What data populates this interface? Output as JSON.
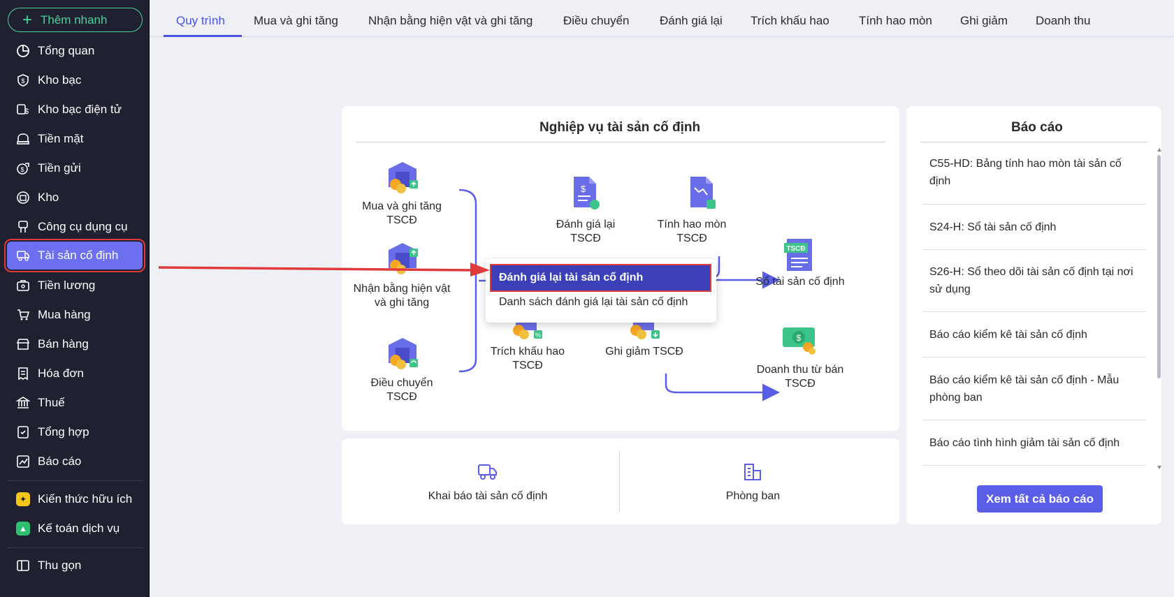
{
  "sidebar": {
    "quick_add": "Thêm nhanh",
    "items": [
      {
        "label": "Tổng quan",
        "icon": "pie-chart-icon"
      },
      {
        "label": "Kho bạc",
        "icon": "dollar-shield-icon"
      },
      {
        "label": "Kho bạc điện tử",
        "icon": "digital-money-icon"
      },
      {
        "label": "Tiền mặt",
        "icon": "cash-icon"
      },
      {
        "label": "Tiền gửi",
        "icon": "deposit-icon"
      },
      {
        "label": "Kho",
        "icon": "warehouse-icon"
      },
      {
        "label": "Công cụ dụng cụ",
        "icon": "tools-icon"
      },
      {
        "label": "Tài sản cố định",
        "icon": "truck-icon",
        "active": true
      },
      {
        "label": "Tiền lương",
        "icon": "salary-icon"
      },
      {
        "label": "Mua hàng",
        "icon": "cart-icon"
      },
      {
        "label": "Bán hàng",
        "icon": "store-icon"
      },
      {
        "label": "Hóa đơn",
        "icon": "invoice-icon"
      },
      {
        "label": "Thuế",
        "icon": "bank-icon"
      },
      {
        "label": "Tổng hợp",
        "icon": "summary-icon"
      },
      {
        "label": "Báo cáo",
        "icon": "report-chart-icon"
      },
      {
        "label": "Kiến thức hữu ích",
        "icon": "knowledge-icon"
      },
      {
        "label": "Kế toán dịch vụ",
        "icon": "service-icon"
      }
    ],
    "collapse": "Thu gọn"
  },
  "tabs": [
    "Quy trình",
    "Mua và ghi tăng",
    "Nhận bằng hiện vật và ghi tăng",
    "Điều chuyển",
    "Đánh giá lại",
    "Trích khấu hao",
    "Tính hao mòn",
    "Ghi giảm",
    "Doanh thu"
  ],
  "process": {
    "title": "Nghiệp vụ tài sản cố định",
    "nodes": {
      "buy": "Mua và ghi tăng TSCĐ",
      "receive": "Nhận bằng hiện vật và ghi tăng",
      "transfer": "Điều chuyển TSCĐ",
      "revalue": "Đánh giá lại TSCĐ",
      "wear": "Tính hao mòn TSCĐ",
      "depreciation": "Trích khấu hao TSCĐ",
      "decrease": "Ghi giảm TSCĐ",
      "ledger": "Sổ tài sản cố định",
      "revenue": "Doanh thu từ bán TSCĐ",
      "ledger_badge": "TSCĐ"
    }
  },
  "dropdown": {
    "item1": "Đánh giá lại tài sản cố định",
    "item2": "Danh sách đánh giá lại tài sản cố định"
  },
  "bottom": {
    "declare": "Khai báo tài sản cố định",
    "department": "Phòng ban"
  },
  "reports": {
    "title": "Báo cáo",
    "items": [
      "C55-HD: Bảng tính hao mòn tài sản cố định",
      "S24-H: Sổ tài sản cố định",
      "S26-H: Sổ theo dõi tài sản cố định tại nơi sử dụng",
      "Báo cáo kiểm kê tài sản cố định",
      "Báo cáo kiểm kê tài sản cố định - Mẫu phòng ban",
      "Báo cáo tình hình giảm tài sản cố định"
    ],
    "view_all": "Xem tất cả báo cáo"
  },
  "colors": {
    "sidebar_bg": "#1f2130",
    "accent": "#5a5de6",
    "quick_add": "#4bd39a",
    "highlight": "#e03a3a"
  }
}
